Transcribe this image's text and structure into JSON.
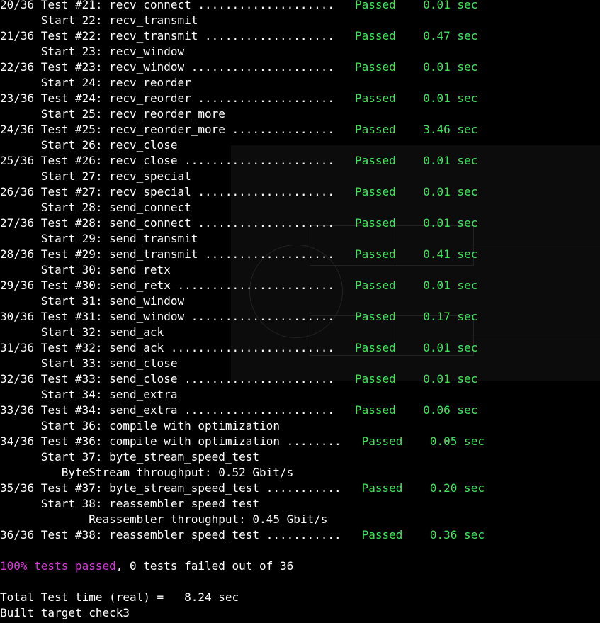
{
  "colors": {
    "background": "#000000",
    "passed_green": "#3ee65a",
    "summary_magenta": "#d63ad6",
    "text": "#ffffff"
  },
  "lines": [
    {
      "type": "test",
      "counter": "20/36",
      "label": "Test #21: recv_connect ....................",
      "status": "Passed",
      "time": "0.01 sec"
    },
    {
      "type": "start",
      "text": "      Start 22: recv_transmit"
    },
    {
      "type": "test",
      "counter": "21/36",
      "label": "Test #22: recv_transmit ...................",
      "status": "Passed",
      "time": "0.47 sec"
    },
    {
      "type": "start",
      "text": "      Start 23: recv_window"
    },
    {
      "type": "test",
      "counter": "22/36",
      "label": "Test #23: recv_window .....................",
      "status": "Passed",
      "time": "0.01 sec"
    },
    {
      "type": "start",
      "text": "      Start 24: recv_reorder"
    },
    {
      "type": "test",
      "counter": "23/36",
      "label": "Test #24: recv_reorder ....................",
      "status": "Passed",
      "time": "0.01 sec"
    },
    {
      "type": "start",
      "text": "      Start 25: recv_reorder_more"
    },
    {
      "type": "test",
      "counter": "24/36",
      "label": "Test #25: recv_reorder_more ...............",
      "status": "Passed",
      "time": "3.46 sec"
    },
    {
      "type": "start",
      "text": "      Start 26: recv_close"
    },
    {
      "type": "test",
      "counter": "25/36",
      "label": "Test #26: recv_close ......................",
      "status": "Passed",
      "time": "0.01 sec"
    },
    {
      "type": "start",
      "text": "      Start 27: recv_special"
    },
    {
      "type": "test",
      "counter": "26/36",
      "label": "Test #27: recv_special ....................",
      "status": "Passed",
      "time": "0.01 sec"
    },
    {
      "type": "start",
      "text": "      Start 28: send_connect"
    },
    {
      "type": "test",
      "counter": "27/36",
      "label": "Test #28: send_connect ....................",
      "status": "Passed",
      "time": "0.01 sec"
    },
    {
      "type": "start",
      "text": "      Start 29: send_transmit"
    },
    {
      "type": "test",
      "counter": "28/36",
      "label": "Test #29: send_transmit ...................",
      "status": "Passed",
      "time": "0.41 sec"
    },
    {
      "type": "start",
      "text": "      Start 30: send_retx"
    },
    {
      "type": "test",
      "counter": "29/36",
      "label": "Test #30: send_retx .......................",
      "status": "Passed",
      "time": "0.01 sec"
    },
    {
      "type": "start",
      "text": "      Start 31: send_window"
    },
    {
      "type": "test",
      "counter": "30/36",
      "label": "Test #31: send_window .....................",
      "status": "Passed",
      "time": "0.17 sec"
    },
    {
      "type": "start",
      "text": "      Start 32: send_ack"
    },
    {
      "type": "test",
      "counter": "31/36",
      "label": "Test #32: send_ack ........................",
      "status": "Passed",
      "time": "0.01 sec"
    },
    {
      "type": "start",
      "text": "      Start 33: send_close"
    },
    {
      "type": "test",
      "counter": "32/36",
      "label": "Test #33: send_close ......................",
      "status": "Passed",
      "time": "0.01 sec"
    },
    {
      "type": "start",
      "text": "      Start 34: send_extra"
    },
    {
      "type": "test",
      "counter": "33/36",
      "label": "Test #34: send_extra ......................",
      "status": "Passed",
      "time": "0.06 sec"
    },
    {
      "type": "start",
      "text": "      Start 36: compile with optimization"
    },
    {
      "type": "test",
      "counter": "34/36",
      "label": "Test #36: compile with optimization ........",
      "status": "Passed",
      "time": "0.05 sec"
    },
    {
      "type": "start",
      "text": "      Start 37: byte_stream_speed_test"
    },
    {
      "type": "info",
      "text": "         ByteStream throughput: 0.52 Gbit/s"
    },
    {
      "type": "test",
      "counter": "35/36",
      "label": "Test #37: byte_stream_speed_test ...........",
      "status": "Passed",
      "time": "0.20 sec"
    },
    {
      "type": "start",
      "text": "      Start 38: reassembler_speed_test"
    },
    {
      "type": "info",
      "text": "             Reassembler throughput: 0.45 Gbit/s"
    },
    {
      "type": "test",
      "counter": "36/36",
      "label": "Test #38: reassembler_speed_test ...........",
      "status": "Passed",
      "time": "0.36 sec"
    },
    {
      "type": "blank",
      "text": ""
    },
    {
      "type": "summary",
      "percent": "100% tests passed",
      "rest": ", 0 tests failed out of 36"
    },
    {
      "type": "blank",
      "text": ""
    },
    {
      "type": "plain",
      "text": "Total Test time (real) =   8.24 sec"
    },
    {
      "type": "plain",
      "text": "Built target check3"
    }
  ]
}
